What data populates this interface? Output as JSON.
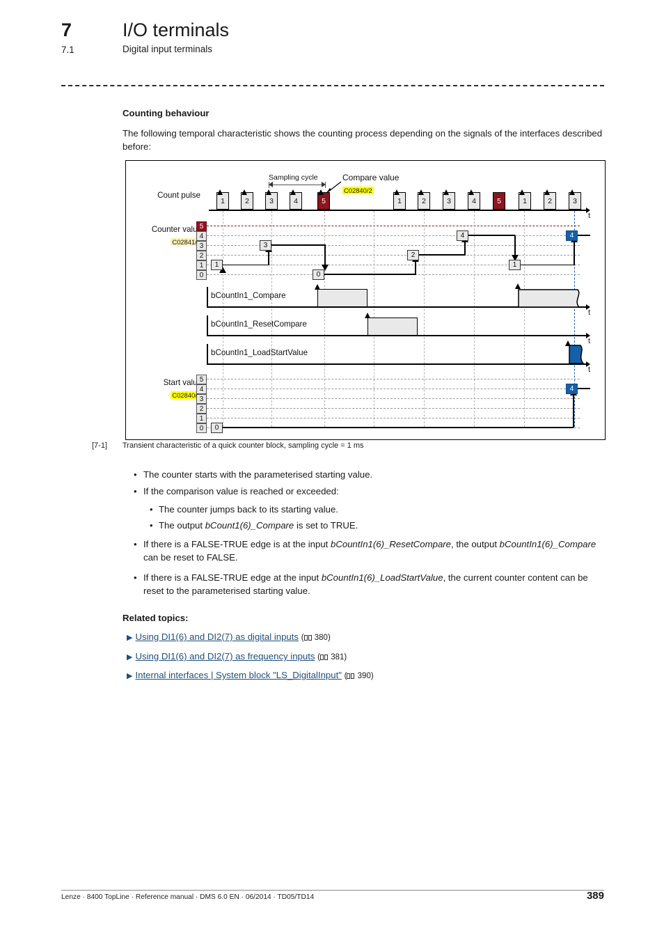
{
  "header": {
    "chapter_number": "7",
    "chapter_title": "I/O terminals",
    "section_number": "7.1",
    "section_title": "Digital input terminals"
  },
  "body": {
    "subheading": "Counting behaviour",
    "intro": "The following temporal characteristic shows the counting process depending on the signals of the interfaces described before:"
  },
  "figure": {
    "caption_number": "[7-1]",
    "caption_text": "Transient characteristic of a quick counter block, sampling cycle = 1 ms",
    "labels": {
      "count_pulse": "Count pulse",
      "counter_value": "Counter value",
      "counter_value_code": "C02841/1",
      "compare_value": "Compare value",
      "compare_value_code": "C02840/2",
      "sampling_cycle": "Sampling cycle",
      "start_value": "Start value",
      "start_value_code": "C02840/1",
      "time_axis": "t"
    },
    "signals": [
      {
        "name": "bCountIn1_Compare"
      },
      {
        "name": "bCountIn1_ResetCompare"
      },
      {
        "name": "bCountIn1_LoadStartValue"
      }
    ],
    "axis_ticks": [
      "5",
      "4",
      "3",
      "2",
      "1",
      "0"
    ],
    "colors": {
      "compare_red": "#8e1420",
      "load_blue": "#1560a8",
      "pulse_grey": "#e8e8e8",
      "highlight_yellow": "#ffff00",
      "highlight_pale": "#fbf0b2"
    }
  },
  "chart_data": {
    "type": "line",
    "title": "Transient characteristic of a quick counter block, sampling cycle = 1 ms",
    "xlabel": "t",
    "ylabel": "Counter value",
    "ylim": [
      0,
      5
    ],
    "yticks": [
      0,
      1,
      2,
      3,
      4,
      5
    ],
    "grid": true,
    "compare_value": 5,
    "start_value_initial": 0,
    "start_value_final": 4,
    "count_pulse_sequence": [
      1,
      2,
      3,
      4,
      5,
      1,
      2,
      3,
      4,
      5,
      1,
      2,
      3
    ],
    "count_pulse_compare_hits": [
      5,
      5
    ],
    "series": [
      {
        "name": "Counter value",
        "values": [
          1,
          3,
          0,
          2,
          4,
          1,
          4
        ],
        "note": "stepwise: 1 then 3 then reset to 0, then 2, 4, reset to 1, load start value 4"
      },
      {
        "name": "Start value",
        "values": [
          0,
          4
        ]
      }
    ]
  },
  "bullets": [
    {
      "level": 1,
      "text": "The counter starts with the parameterised starting value."
    },
    {
      "level": 1,
      "text": "If the comparison value is reached or exceeded:"
    },
    {
      "level": 2,
      "text": "The counter jumps back to its starting value."
    },
    {
      "level": 2,
      "text": "The output bCount1(6)_Compare is set to TRUE.",
      "italic_part": "bCount1(6)_Compare"
    },
    {
      "level": 1,
      "text": "If there is a FALSE-TRUE edge is at the input bCountIn1(6)_ResetCompare, the output bCountIn1(6)_Compare can be reset to FALSE."
    },
    {
      "level": 1,
      "text": "If there is a FALSE-TRUE edge at the input bCountIn1(6)_LoadStartValue, the current counter content can be reset to the parameterised starting value."
    }
  ],
  "bullet_text": {
    "b1": "The counter starts with the parameterised starting value.",
    "b2": "If the comparison value is reached or exceeded:",
    "b3": "The counter jumps back to its starting value.",
    "b4_pre": "The output ",
    "b4_em": "bCount1(6)_Compare",
    "b4_post": " is set to TRUE.",
    "b5_pre": "If there is a FALSE-TRUE edge is at the input ",
    "b5_em1": "bCountIn1(6)_ResetCompare",
    "b5_mid": ", the output ",
    "b5_em2": "bCountIn1(6)_Compare",
    "b5_post": " can be reset to FALSE.",
    "b6_pre": "If there is a FALSE-TRUE edge at the input ",
    "b6_em": "bCountIn1(6)_LoadStartValue",
    "b6_post": ", the current counter content can be reset to the parameterised starting value."
  },
  "related": {
    "heading": "Related topics:",
    "items": [
      {
        "label": "Using DI1(6) and DI2(7) as digital inputs",
        "page": "380"
      },
      {
        "label": "Using DI1(6) and DI2(7) as frequency inputs",
        "page": "381"
      },
      {
        "label": "Internal interfaces | System block \"LS_DigitalInput\"",
        "page": "390"
      }
    ]
  },
  "footer": {
    "text": "Lenze · 8400 TopLine · Reference manual · DMS 6.0 EN · 06/2014 · TD05/TD14",
    "page_number": "389"
  }
}
